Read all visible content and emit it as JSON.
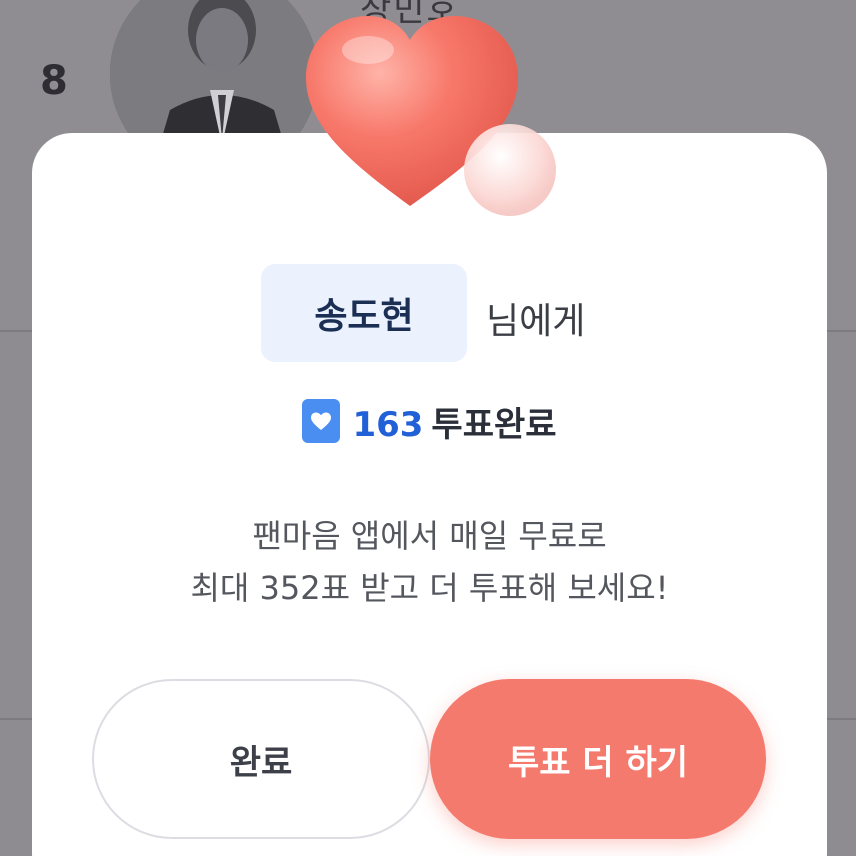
{
  "background": {
    "rank": "8",
    "name": "장민호"
  },
  "modal": {
    "recipient_name": "송도현",
    "recipient_suffix": "님에게",
    "vote_count": "163",
    "vote_status": "투표완료",
    "message_line1": "팬마음 앱에서 매일 무료로",
    "message_line2": "최대 352표 받고 더 투표해 보세요!",
    "buttons": {
      "done": "완료",
      "vote_more": "투표 더 하기"
    }
  },
  "colors": {
    "accent": "#f47a6d",
    "vote_blue": "#2160d6",
    "icon_blue": "#4a8ef2",
    "chip_bg": "#ebf2fd"
  },
  "icons": {
    "vote": "heart-icon",
    "decoration": "heart-illustration"
  }
}
